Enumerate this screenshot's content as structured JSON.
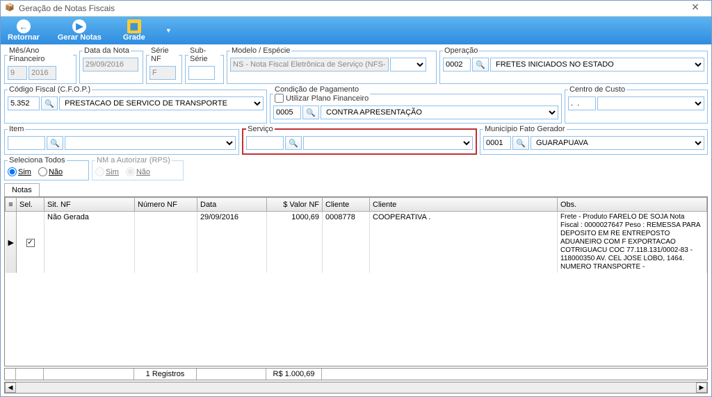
{
  "window": {
    "title": "Geração de Notas Fiscais"
  },
  "toolbar": {
    "retornar": "Retornar",
    "gerar_notas": "Gerar Notas",
    "grade": "Grade"
  },
  "fields": {
    "mes_ano": {
      "label": "Mês/Ano Financeiro",
      "mes": "9",
      "ano": "2016"
    },
    "data_nota": {
      "label": "Data da Nota",
      "value": "29/09/2016"
    },
    "serie": {
      "label": "Série NF",
      "value": "F"
    },
    "subserie": {
      "label": "Sub-Série",
      "value": ""
    },
    "modelo": {
      "label": "Modelo / Espécie",
      "value": "NS - Nota Fiscal Eletrônica de Serviço (NFS-",
      "aux": ""
    },
    "operacao": {
      "label": "Operação",
      "code": "0002",
      "desc": "FRETES INICIADOS NO ESTADO"
    },
    "cfop": {
      "label": "Código Fiscal (C.F.O.P.)",
      "code": "5.352",
      "desc": "PRESTACAO DE SERVICO DE TRANSPORTE"
    },
    "cond_pag": {
      "label": "Condição de Pagamento",
      "check_label": "Utilizar Plano Financeiro",
      "code": "0005",
      "desc": "CONTRA APRESENTAÇÃO"
    },
    "centro_custo": {
      "label": "Centro de Custo",
      "code": ".  .",
      "desc": ""
    },
    "item": {
      "label": "Item",
      "code": "",
      "desc": ""
    },
    "servico": {
      "label": "Serviço",
      "code": "",
      "desc": ""
    },
    "municipio": {
      "label": "Município Fato Gerador",
      "code": "0001",
      "desc": "GUARAPUAVA"
    },
    "sel_todos": {
      "label": "Seleciona Todos",
      "sim": "Sim",
      "nao": "Não"
    },
    "nm_aut": {
      "label": "NM a Autorizar (RPS)",
      "sim": "Sim",
      "nao": "Não"
    }
  },
  "tabs": {
    "notas": "Notas"
  },
  "grid": {
    "headers": {
      "sel": "Sel.",
      "sit": "Sit. NF",
      "numero": "Número NF",
      "data": "Data",
      "valor": "$ Valor NF",
      "cliente_cod": "Cliente",
      "cliente_nome": "Cliente",
      "obs": "Obs."
    },
    "rows": [
      {
        "sel": true,
        "sit": "Não Gerada",
        "numero": "",
        "data": "29/09/2016",
        "valor": "1000,69",
        "cliente_cod": "0008778",
        "cliente_nome": "COOPERATIVA .",
        "obs": "Frete - Produto FARELO DE SOJA Nota Fiscal : 0000027647 Peso : REMESSA PARA DEPOSITO EM RE ENTREPOSTO ADUANEIRO COM F EXPORTACAO COTRIGUACU COC 77.118.131/0002-83 - 118000350 AV. CEL JOSE LOBO, 1464. NUMERO TRANSPORTE -"
      }
    ],
    "footer": {
      "registros": "1 Registros",
      "total": "R$ 1.000,69"
    }
  }
}
